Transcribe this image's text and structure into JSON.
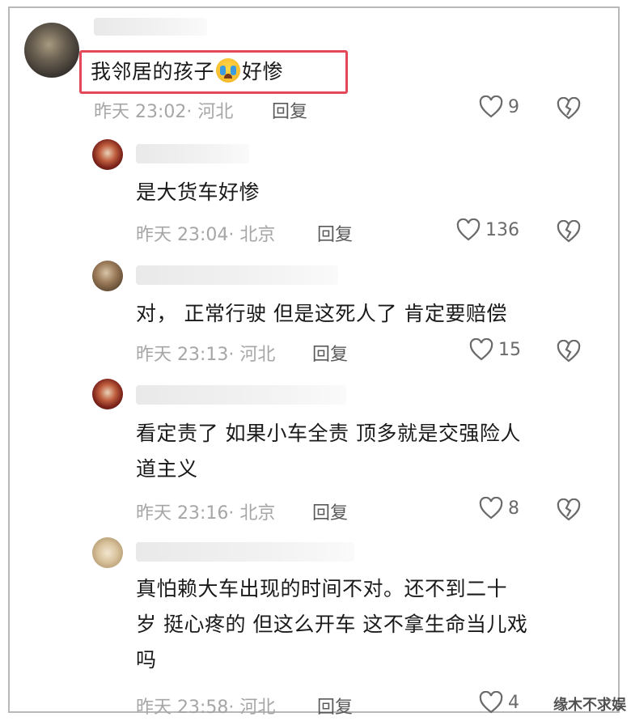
{
  "comments": [
    {
      "text_before": "我邻居的孩子",
      "text_after": "好惨",
      "emoji": "crying-face",
      "meta": "昨天 23:02· 河北",
      "reply": "回复",
      "likes": "9"
    },
    {
      "text": "是大货车好惨",
      "meta": "昨天 23:04· 北京",
      "reply": "回复",
      "likes": "136"
    },
    {
      "text": "对， 正常行驶 但是这死人了 肯定要赔偿",
      "meta": "昨天 23:13· 河北",
      "reply": "回复",
      "likes": "15"
    },
    {
      "text_line1": "看定责了 如果小车全责 顶多就是交强险人",
      "text_line2": "道主义",
      "meta": "昨天 23:16· 北京",
      "reply": "回复",
      "likes": "8"
    },
    {
      "text_line1": "真怕赖大车出现的时间不对。还不到二十",
      "text_line2": "岁 挺心疼的 但这么开车 这不拿生命当儿戏",
      "text_line3": "吗",
      "meta": "昨天 23:58· 河北",
      "reply": "回复",
      "likes": "4"
    }
  ],
  "watermark": "缘木不求娱",
  "colors": {
    "highlight": "#e24858",
    "meta": "#a6a6a6",
    "text": "#1a1a1a"
  }
}
